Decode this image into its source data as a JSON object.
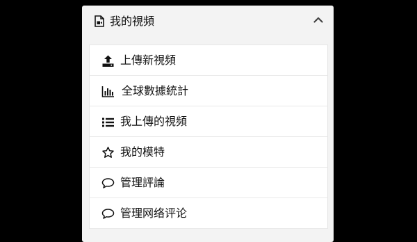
{
  "panel": {
    "title": "我的視頻",
    "title_icon": "video-file-icon",
    "toggle_icon": "chevron-up-icon"
  },
  "menu": {
    "items": [
      {
        "label": "上傳新視頻",
        "icon": "upload-icon"
      },
      {
        "label": "全球數據統計",
        "icon": "bar-chart-icon"
      },
      {
        "label": "我上傳的視頻",
        "icon": "list-icon"
      },
      {
        "label": "我的模特",
        "icon": "star-icon"
      },
      {
        "label": "管理評論",
        "icon": "comment-icon"
      },
      {
        "label": "管理网络评论",
        "icon": "comment-icon"
      }
    ]
  }
}
